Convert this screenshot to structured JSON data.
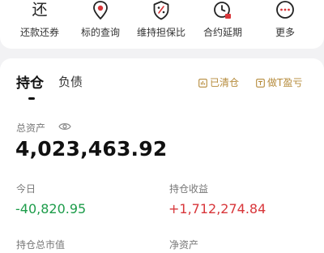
{
  "shortcuts": [
    {
      "label": "还款还券",
      "icon": "repay-char-icon",
      "glyph": "还"
    },
    {
      "label": "标的查询",
      "icon": "location-pin-icon"
    },
    {
      "label": "维持担保比",
      "icon": "shield-percent-icon"
    },
    {
      "label": "合约延期",
      "icon": "clock-calendar-icon"
    },
    {
      "label": "更多",
      "icon": "more-dots-icon"
    }
  ],
  "tabs": {
    "holdings": "持仓",
    "liabilities": "负债"
  },
  "actions": {
    "cleared": "已清仓",
    "t_trade": "做T盈亏"
  },
  "summary": {
    "total_assets_label": "总资产",
    "total_assets_value": "4,023,463.92",
    "today_label": "今日",
    "today_value": "-40,820.95",
    "position_profit_label": "持仓收益",
    "position_profit_value": "+1,712,274.84",
    "partial_label_1": "持仓总市值",
    "partial_label_2": "净资产"
  },
  "colors": {
    "accent_gold": "#b58a3a",
    "loss_green": "#1d9c4a",
    "gain_red": "#d8363a",
    "pin_red": "#d8363a"
  }
}
